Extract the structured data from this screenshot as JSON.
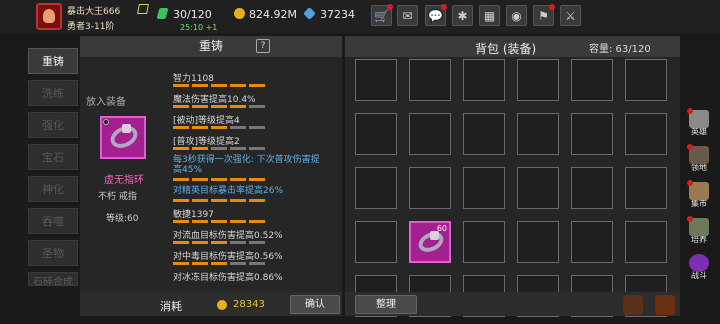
{
  "player": {
    "name": "暴击大王666",
    "rank": "勇者3-11阶",
    "energy": "30/120",
    "energy_timer": "25:10 +1",
    "gold": "824.92M",
    "gems": "37234"
  },
  "top_icons": [
    "shop-icon",
    "mail-icon",
    "chat-icon",
    "settings-icon",
    "gift-icon",
    "wheel-icon",
    "event-icon",
    "battle-icon"
  ],
  "left_tabs": [
    "重铸",
    "洗练",
    "强化",
    "宝石",
    "神化",
    "吞噬",
    "圣物",
    "石碎合成"
  ],
  "forge": {
    "title": "重铸",
    "help": "?",
    "place_label": "放入装备",
    "item_name": "虚无指环",
    "item_tags": "不朽 戒指",
    "item_level": "等级:60",
    "stats": [
      {
        "text": "智力1108",
        "filled": 5,
        "total": 5,
        "blue": false
      },
      {
        "text": "魔法伤害提高10.4%",
        "filled": 4,
        "total": 5,
        "blue": false
      },
      {
        "text": "[被动]等级提高4",
        "filled": 3,
        "total": 5,
        "blue": false
      },
      {
        "text": "[普攻]等级提高2",
        "filled": 2,
        "total": 5,
        "blue": false
      },
      {
        "text": "每3秒获得一次强化: 下次普攻伤害提高45%",
        "filled": 5,
        "total": 5,
        "blue": true
      },
      {
        "text": "对精英目标暴击率提高26%",
        "filled": 5,
        "total": 5,
        "blue": true
      },
      {
        "text": "敏捷1397",
        "filled": 5,
        "total": 5,
        "blue": false
      },
      {
        "text": "对流血目标伤害提高0.52%",
        "filled": 3,
        "total": 5,
        "blue": false
      },
      {
        "text": "对中毒目标伤害提高0.56%",
        "filled": 3,
        "total": 5,
        "blue": false
      },
      {
        "text": "对冰冻目标伤害提高0.86%",
        "filled": 3,
        "total": 5,
        "blue": false
      }
    ],
    "cost_label": "消耗",
    "cost_value": "28343",
    "confirm": "确认"
  },
  "bag": {
    "title": "背包 (装备)",
    "capacity": "容量: 63/120",
    "sort": "整理",
    "item_count": "60"
  },
  "right_menu": [
    "英雄",
    "领地",
    "集市",
    "培养",
    "战斗"
  ]
}
